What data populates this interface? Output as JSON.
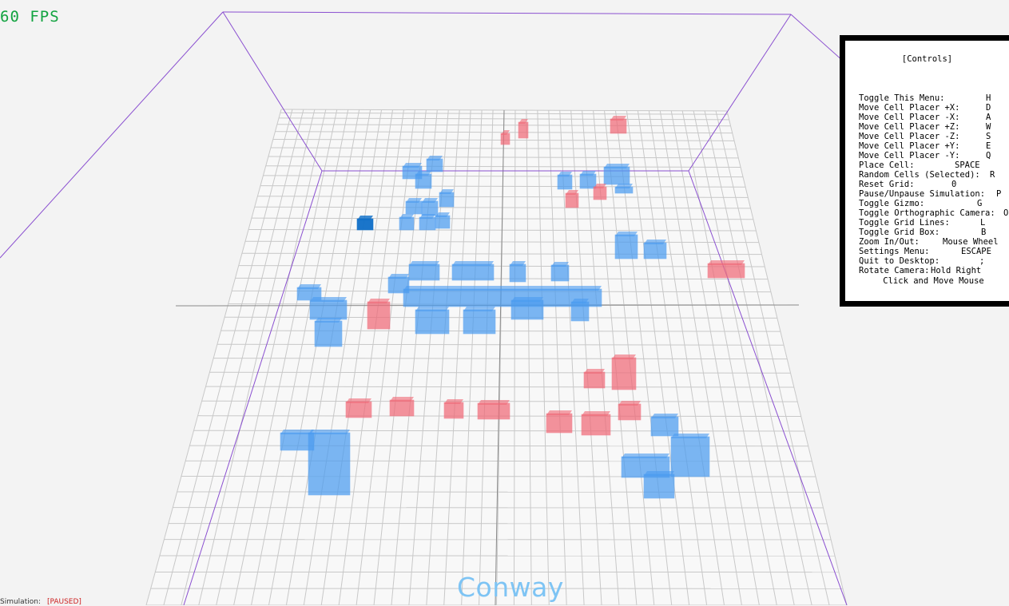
{
  "hud": {
    "fps": "60 FPS",
    "title": "Conway",
    "simulation_label": "Simulation:",
    "simulation_status": "[PAUSED]"
  },
  "controls": {
    "title": "[Controls]",
    "items": [
      {
        "action": "Toggle This Menu:",
        "key": "H"
      },
      {
        "action": "Move Cell Placer +X:",
        "key": "D"
      },
      {
        "action": "Move Cell Placer -X:",
        "key": "A"
      },
      {
        "action": "Move Cell Placer +Z:",
        "key": "W"
      },
      {
        "action": "Move Cell Placer -Z:",
        "key": "S"
      },
      {
        "action": "Move Cell Placer +Y:",
        "key": "E"
      },
      {
        "action": "Move Cell Placer -Y:",
        "key": "Q"
      },
      {
        "action": "Place Cell:",
        "key": "SPACE"
      },
      {
        "action": "Random Cells (Selected):",
        "key": "R"
      },
      {
        "action": "Reset Grid:",
        "key": "0"
      },
      {
        "action": "Pause/Unpause Simulation:",
        "key": "P"
      },
      {
        "action": "Toggle Gizmo:",
        "key": "G"
      },
      {
        "action": "Toggle Orthographic Camera:",
        "key": "O"
      },
      {
        "action": "Toggle Grid Lines:",
        "key": "L"
      },
      {
        "action": "Toggle Grid Box:",
        "key": "B"
      },
      {
        "action": "Zoom In/Out:",
        "key": "Mouse Wheel"
      },
      {
        "action": "Settings Menu:",
        "key": "ESCAPE"
      },
      {
        "action": "Quit to Desktop:",
        "key": ";"
      },
      {
        "action": "Rotate Camera:",
        "key": "Hold Right"
      }
    ],
    "extra": "Click and Move Mouse"
  },
  "colors": {
    "background": "#f3f3f3",
    "grid_line": "#c8c8c8",
    "box_edge": "#8a4fd0",
    "blue_cell": "#4b9cf0",
    "red_cell": "#f06a78",
    "selector_cell": "#0f6fc8",
    "fps_text": "#12a340",
    "title_text": "#7ec4f4"
  }
}
